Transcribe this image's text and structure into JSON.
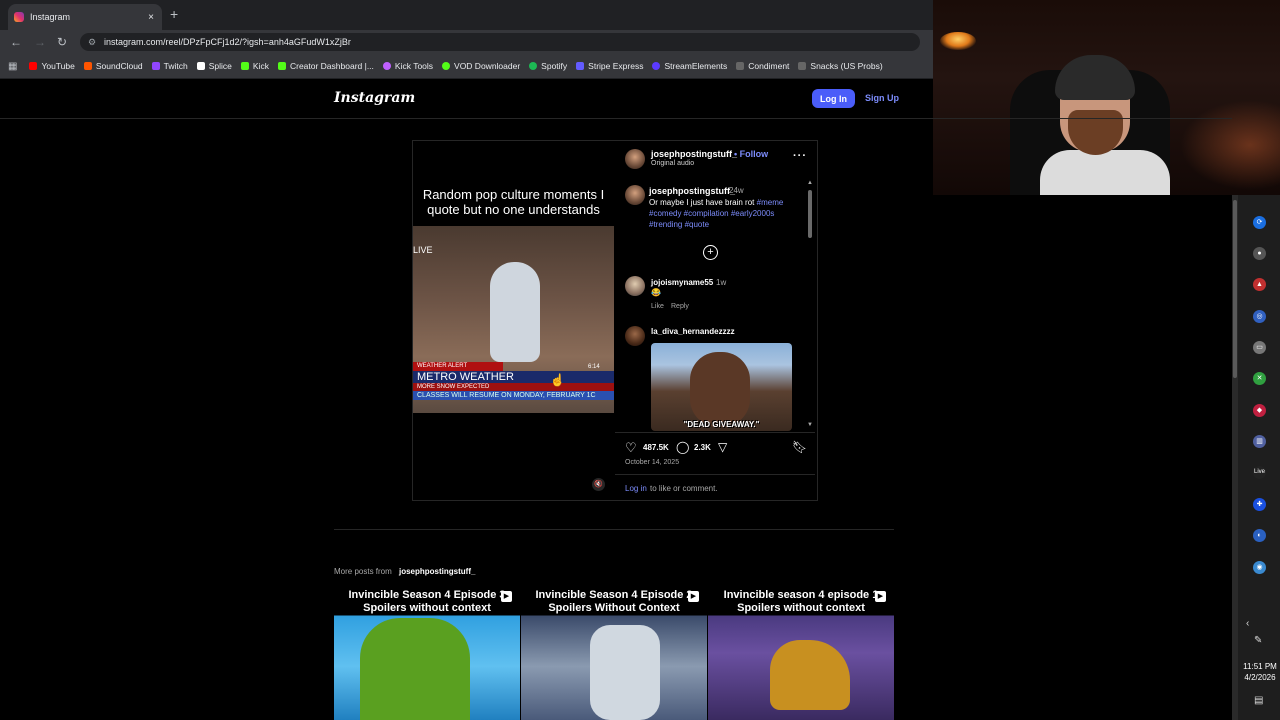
{
  "browser": {
    "tab_title": "Instagram",
    "tab_close": "×",
    "new_tab": "+",
    "url": "instagram.com/reel/DPzFpCFj1d2/?igsh=anh4aGFudW1xZjBr",
    "bookmarks": [
      {
        "label": "YouTube",
        "color": "#ff0000"
      },
      {
        "label": "SoundCloud",
        "color": "#ff5500"
      },
      {
        "label": "Twitch",
        "color": "#9146ff"
      },
      {
        "label": "Splice",
        "color": "#ffffff"
      },
      {
        "label": "Kick",
        "color": "#53fc18"
      },
      {
        "label": "Creator Dashboard |...",
        "color": "#53fc18"
      },
      {
        "label": "Kick Tools",
        "color": "#c060ff"
      },
      {
        "label": "VOD Downloader",
        "color": "#53fc18"
      },
      {
        "label": "Spotify",
        "color": "#1db954"
      },
      {
        "label": "Stripe Express",
        "color": "#635bff"
      },
      {
        "label": "StreamElements",
        "color": "#5b3aff"
      },
      {
        "label": "Condiment",
        "color": "#444444"
      },
      {
        "label": "Snacks (US Probs)",
        "color": "#444444"
      }
    ]
  },
  "instagram": {
    "logo": "Instagram",
    "login_button": "Log In",
    "signup_link": "Sign Up"
  },
  "video": {
    "caption": "Random pop culture moments I quote but no one understands",
    "live_label": "LIVE",
    "weather_alert": "WEATHER ALERT",
    "metro_weather": "METRO WEATHER",
    "more_snow": "MORE SNOW EXPECTED",
    "classes": "CLASSES WILL RESUME ON MONDAY, FEBRUARY 1C",
    "time": "6:14",
    "mute_icon": "🔇"
  },
  "post": {
    "username": "josephpostingstuff_",
    "follow": "• Follow",
    "audio": "Original audio",
    "more": "···",
    "caption_user": "josephpostingstuff_",
    "caption_time": "24w",
    "caption_text": "Or maybe I just have brain rot",
    "caption_tags": "#meme #comedy #compilation #early2000s #trending #quote",
    "load_more": "+",
    "comments": [
      {
        "user": "jojoismyname55",
        "time": "1w",
        "text": "😂",
        "like": "Like",
        "reply": "Reply"
      },
      {
        "user": "la_diva_hernandezzzz",
        "gif_text": "\"DEAD GIVEAWAY.\""
      }
    ],
    "likes": "487.5K",
    "comment_count": "2.3K",
    "date": "October 14, 2025",
    "login_link": "Log in",
    "login_text": "to like or comment."
  },
  "more_posts": {
    "label": "More posts from",
    "user": "josephpostingstuff_",
    "thumbnails": [
      {
        "caption": "Invincible Season 4 Episode 3 Spoilers without context"
      },
      {
        "caption": "Invincible Season 4 Episode 2 Spoilers Without Context"
      },
      {
        "caption": "Invincible season 4 episode 1 Spoilers without context"
      }
    ]
  },
  "taskbar": {
    "time": "11:51 PM",
    "date": "4/2/2026",
    "live_label": "Live"
  }
}
